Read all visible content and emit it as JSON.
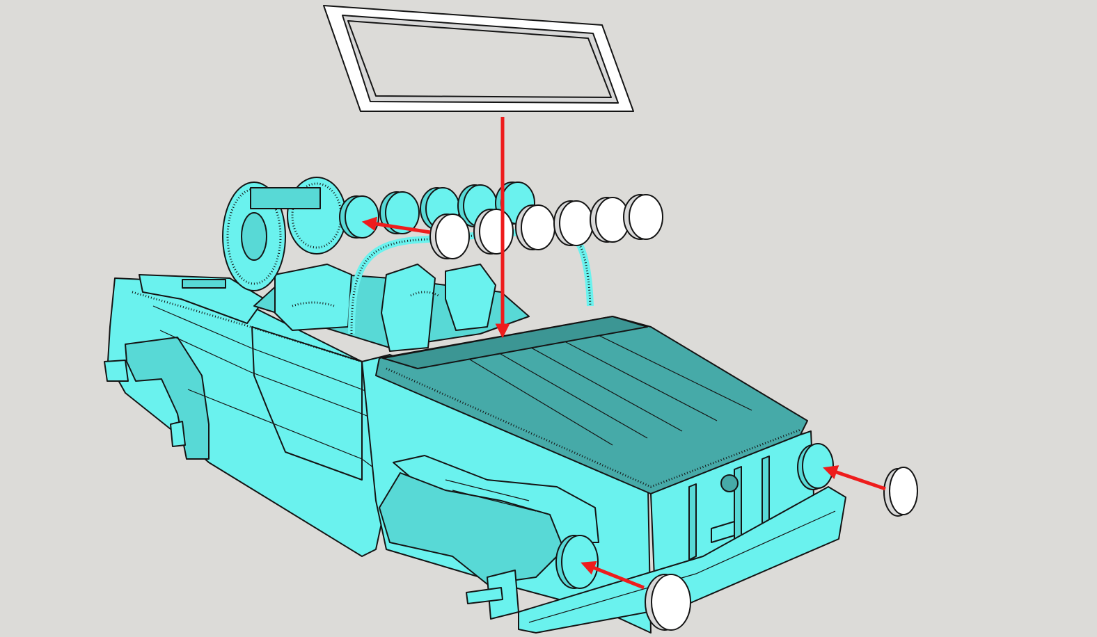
{
  "canvas": {
    "background": "#dcdbd8"
  },
  "colors": {
    "body": "#6af2ee",
    "body_shade": "#58d9d6",
    "hood": "#46aaa8",
    "hood_dark": "#3c9694",
    "part_unassigned": "#ffffff",
    "part_shade": "#d8d8d8",
    "edge": "#141414",
    "arrow": "#ee1c1c"
  },
  "scene": {
    "model": "cabriolet-utility-vehicle",
    "parts": [
      {
        "name": "windshield-frame",
        "state": "detached",
        "color": "#ffffff"
      },
      {
        "name": "light-bar-lamps",
        "state": "detached",
        "count": 6,
        "color": "#ffffff"
      },
      {
        "name": "light-bar-lamps-mounted",
        "state": "attached",
        "count": 5,
        "color": "#6af2ee"
      },
      {
        "name": "front-right-headlight",
        "state": "detached",
        "color": "#ffffff"
      },
      {
        "name": "front-left-headlight",
        "state": "detached",
        "color": "#ffffff"
      },
      {
        "name": "spare-tires",
        "state": "attached",
        "count": 2,
        "color": "#6af2ee"
      }
    ],
    "arrows": [
      {
        "name": "windshield-arrow",
        "icon": "arrow-down",
        "from": "windshield-frame",
        "to": "cowl"
      },
      {
        "name": "lamp-arrow",
        "icon": "arrow-left",
        "from": "light-bar-lamps",
        "to": "light-bar"
      },
      {
        "name": "right-headlight-arrow",
        "icon": "arrow-left",
        "from": "front-right-headlight",
        "to": "front-right-mount"
      },
      {
        "name": "left-headlight-arrow",
        "icon": "arrow-left",
        "from": "front-left-headlight",
        "to": "front-left-mount"
      }
    ]
  }
}
